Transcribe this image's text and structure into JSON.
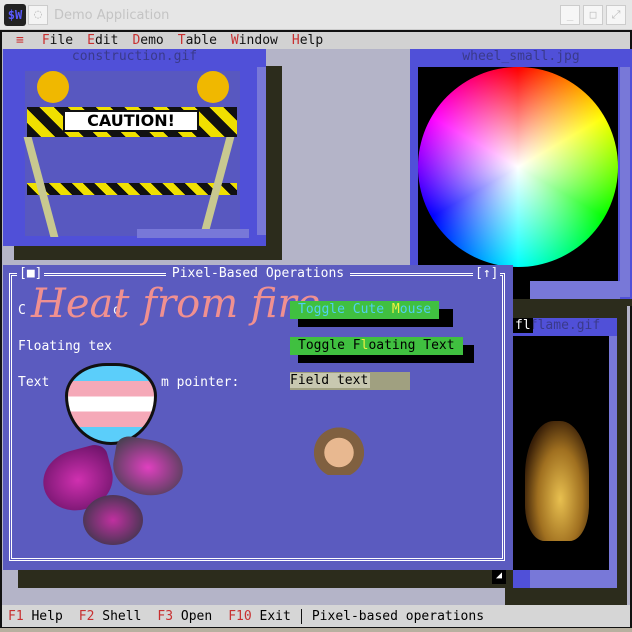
{
  "titlebar": {
    "icon": "$W",
    "title": "Demo Application",
    "buttons": [
      "minimize",
      "maximize",
      "close"
    ]
  },
  "menubar": {
    "system_icon": "≡",
    "items": [
      {
        "hotkey": "F",
        "rest": "ile"
      },
      {
        "hotkey": "E",
        "rest": "dit"
      },
      {
        "hotkey": "D",
        "rest": "emo"
      },
      {
        "hotkey": "T",
        "rest": "able"
      },
      {
        "hotkey": "W",
        "rest": "indow"
      },
      {
        "hotkey": "H",
        "rest": "elp"
      }
    ]
  },
  "windows": {
    "construction": {
      "title": "construction.gif",
      "sign_text": "CAUTION!"
    },
    "wheel": {
      "title": "wheel_small.jpg"
    },
    "flame": {
      "title": "flame.gif",
      "overlay_text": "fl"
    }
  },
  "dialog": {
    "title": "Pixel-Based Operations",
    "close_icon": "[■]",
    "zoom_icon": "[↑]",
    "script_text": "Heat from fire",
    "label1_a": "C",
    "label1_b": "o",
    "label2": "Floating tex",
    "label3_a": "Text",
    "label3_b": "m pointer:",
    "button1": {
      "pre": "Toggle Cute ",
      "hotkey": "M",
      "post": "ouse"
    },
    "button2": {
      "pre": "Toggle F",
      "hotkey": "l",
      "post": "oating Text"
    },
    "field_value": "Field text"
  },
  "statusbar": {
    "items": [
      {
        "key": "F1",
        "label": " Help"
      },
      {
        "key": "F2",
        "label": " Shell"
      },
      {
        "key": "F3",
        "label": " Open"
      },
      {
        "key": "F10",
        "label": " Exit"
      }
    ],
    "message": "Pixel-based operations"
  },
  "colors": {
    "accent": "#c83030",
    "dialog_bg": "#5b5bbf",
    "button": "#40c040"
  }
}
